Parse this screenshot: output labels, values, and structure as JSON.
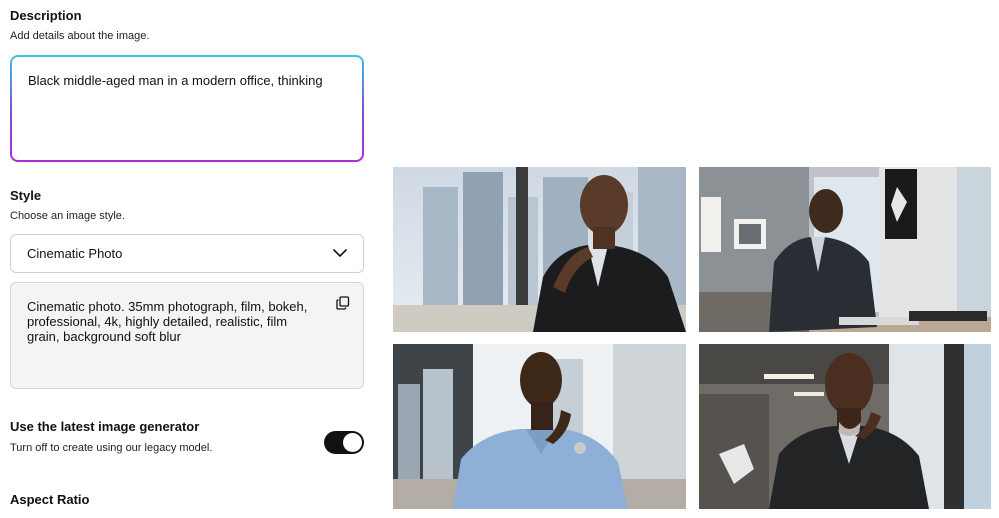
{
  "description": {
    "title": "Description",
    "subtitle": "Add details about the image.",
    "value": "Black middle-aged man in a modern office, thinking"
  },
  "style": {
    "title": "Style",
    "subtitle": "Choose an image style.",
    "selected": "Cinematic Photo",
    "prompt": "Cinematic photo. 35mm photograph, film, bokeh, professional, 4k, highly detailed, realistic, film grain, background soft blur"
  },
  "generator": {
    "title": "Use the latest image generator",
    "subtitle": "Turn off to create using our legacy model.",
    "enabled": true
  },
  "aspect": {
    "title": "Aspect Ratio"
  },
  "colors": {
    "accent_start": "#38c6e6",
    "accent_end": "#b02ad8",
    "toggle_on": "#111111"
  },
  "icons": [
    "chevron-down-icon",
    "copy-icon"
  ],
  "images": [
    {
      "name": "generated-image-1"
    },
    {
      "name": "generated-image-2"
    },
    {
      "name": "generated-image-3"
    },
    {
      "name": "generated-image-4"
    }
  ]
}
